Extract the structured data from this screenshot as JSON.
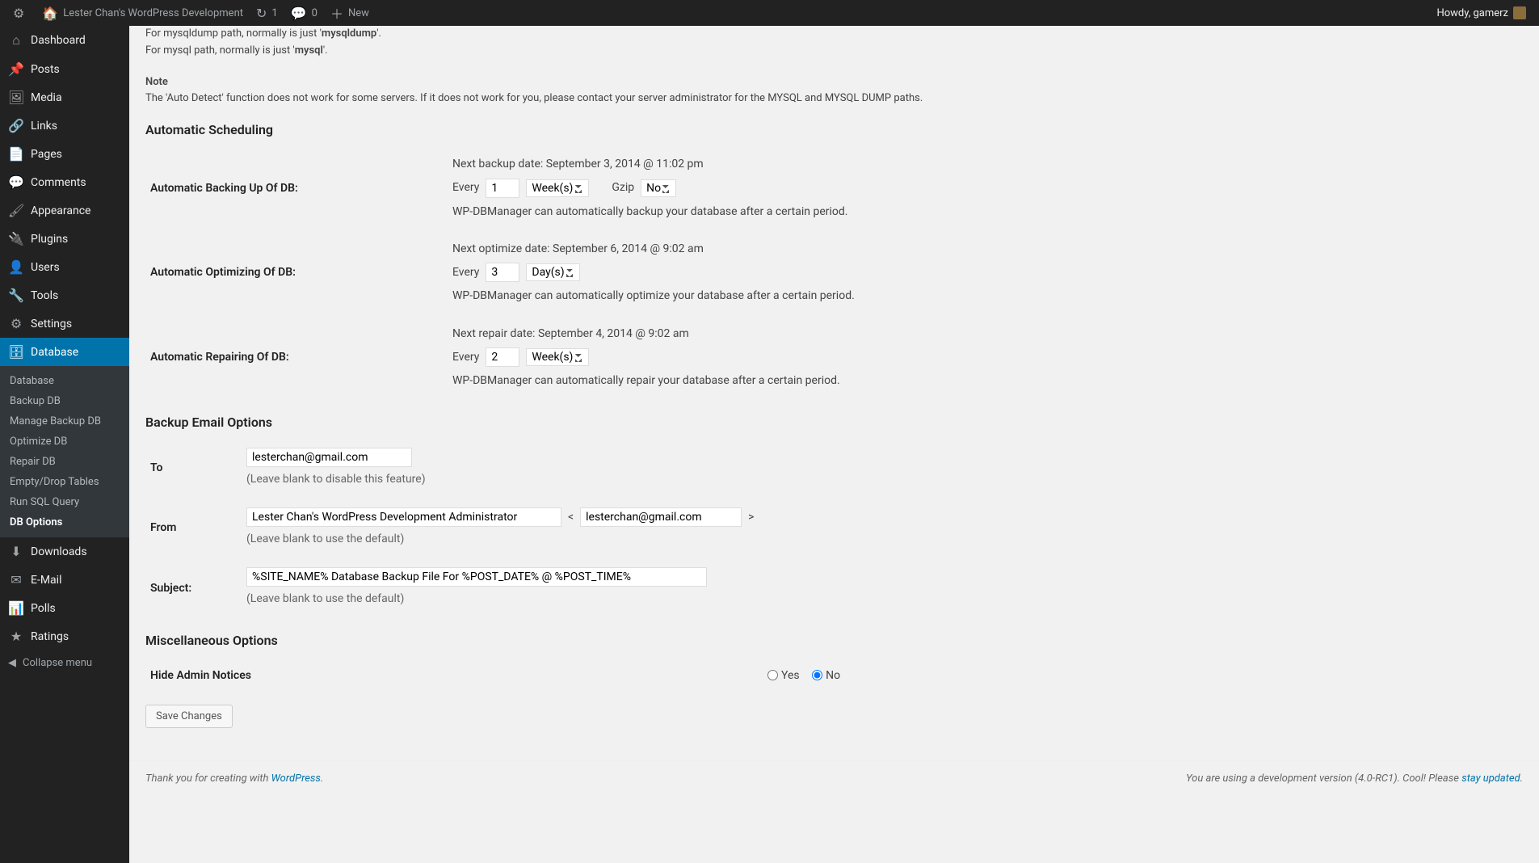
{
  "adminbar": {
    "site_title": "Lester Chan's WordPress Development",
    "updates": "1",
    "comments": "0",
    "new_label": "New",
    "howdy": "Howdy, gamerz"
  },
  "sidebar": {
    "items": [
      {
        "label": "Dashboard",
        "icon": "dashboard"
      },
      {
        "label": "Posts",
        "icon": "pin"
      },
      {
        "label": "Media",
        "icon": "media"
      },
      {
        "label": "Links",
        "icon": "link"
      },
      {
        "label": "Pages",
        "icon": "page"
      },
      {
        "label": "Comments",
        "icon": "comment"
      },
      {
        "label": "Appearance",
        "icon": "brush"
      },
      {
        "label": "Plugins",
        "icon": "plugin"
      },
      {
        "label": "Users",
        "icon": "user"
      },
      {
        "label": "Tools",
        "icon": "tool"
      },
      {
        "label": "Settings",
        "icon": "settings"
      },
      {
        "label": "Database",
        "icon": "database",
        "current": true
      },
      {
        "label": "Downloads",
        "icon": "download"
      },
      {
        "label": "E-Mail",
        "icon": "email"
      },
      {
        "label": "Polls",
        "icon": "poll"
      },
      {
        "label": "Ratings",
        "icon": "star"
      }
    ],
    "submenu": [
      {
        "label": "Database"
      },
      {
        "label": "Backup DB"
      },
      {
        "label": "Manage Backup DB"
      },
      {
        "label": "Optimize DB"
      },
      {
        "label": "Repair DB"
      },
      {
        "label": "Empty/Drop Tables"
      },
      {
        "label": "Run SQL Query"
      },
      {
        "label": "DB Options",
        "current": true
      }
    ],
    "collapse": "Collapse menu"
  },
  "intro": {
    "line1_a": "For mysqldump path, normally is just '",
    "line1_b": "mysqldump",
    "line1_c": "'.",
    "line2_a": "For mysql path, normally is just '",
    "line2_b": "mysql",
    "line2_c": "'.",
    "note_title": "Note",
    "note_body": "The 'Auto Detect' function does not work for some servers. If it does not work for you, please contact your server administrator for the MYSQL and MYSQL DUMP paths."
  },
  "scheduling": {
    "heading": "Automatic Scheduling",
    "backup": {
      "label": "Automatic Backing Up Of DB:",
      "next_label": "Next backup date: ",
      "next_value": "September 3, 2014 @ 11:02 pm",
      "every": "Every",
      "value": "1",
      "period": "Week(s)",
      "gzip_label": "Gzip",
      "gzip_value": "No",
      "desc": "WP-DBManager can automatically backup your database after a certain period."
    },
    "optimize": {
      "label": "Automatic Optimizing Of DB:",
      "next_label": "Next optimize date: ",
      "next_value": "September 6, 2014 @ 9:02 am",
      "every": "Every",
      "value": "3",
      "period": "Day(s)",
      "desc": "WP-DBManager can automatically optimize your database after a certain period."
    },
    "repair": {
      "label": "Automatic Repairing Of DB:",
      "next_label": "Next repair date: ",
      "next_value": "September 4, 2014 @ 9:02 am",
      "every": "Every",
      "value": "2",
      "period": "Week(s)",
      "desc": "WP-DBManager can automatically repair your database after a certain period."
    }
  },
  "email": {
    "heading": "Backup Email Options",
    "to_label": "To",
    "to_value": "lesterchan@gmail.com",
    "to_hint": "(Leave blank to disable this feature)",
    "from_label": "From",
    "from_name": "Lester Chan's WordPress Development Administrator",
    "from_lt": "<",
    "from_email": "lesterchan@gmail.com",
    "from_gt": ">",
    "from_hint": "(Leave blank to use the default)",
    "subject_label": "Subject:",
    "subject_value": "%SITE_NAME% Database Backup File For %POST_DATE% @ %POST_TIME%",
    "subject_hint": "(Leave blank to use the default)"
  },
  "misc": {
    "heading": "Miscellaneous Options",
    "hide_label": "Hide Admin Notices",
    "yes": "Yes",
    "no": "No"
  },
  "save_button": "Save Changes",
  "footer": {
    "left_a": "Thank you for creating with ",
    "left_link": "WordPress",
    "left_b": ".",
    "right_a": "You are using a development version (4.0-RC1). Cool! Please ",
    "right_link": "stay updated",
    "right_b": "."
  }
}
